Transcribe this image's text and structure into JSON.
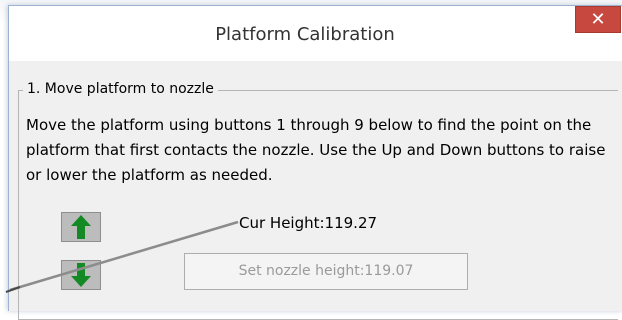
{
  "dialog": {
    "title": "Platform Calibration",
    "close_icon": "close-icon",
    "close_glyph": "✕",
    "accent_close": "#c7483f"
  },
  "group": {
    "legend": "1. Move platform to nozzle",
    "description": "Move the platform using buttons 1 through 9 below to find the point on the platform that first contacts the nozzle. Use the Up and Down buttons to raise or lower the platform as needed."
  },
  "controls": {
    "up_icon": "arrow-up-icon",
    "down_icon": "arrow-down-icon",
    "arrow_color": "#138a24",
    "cur_height": "Cur Height:119.27",
    "set_nozzle_label": "Set nozzle height:119.07",
    "set_nozzle_enabled": false
  }
}
